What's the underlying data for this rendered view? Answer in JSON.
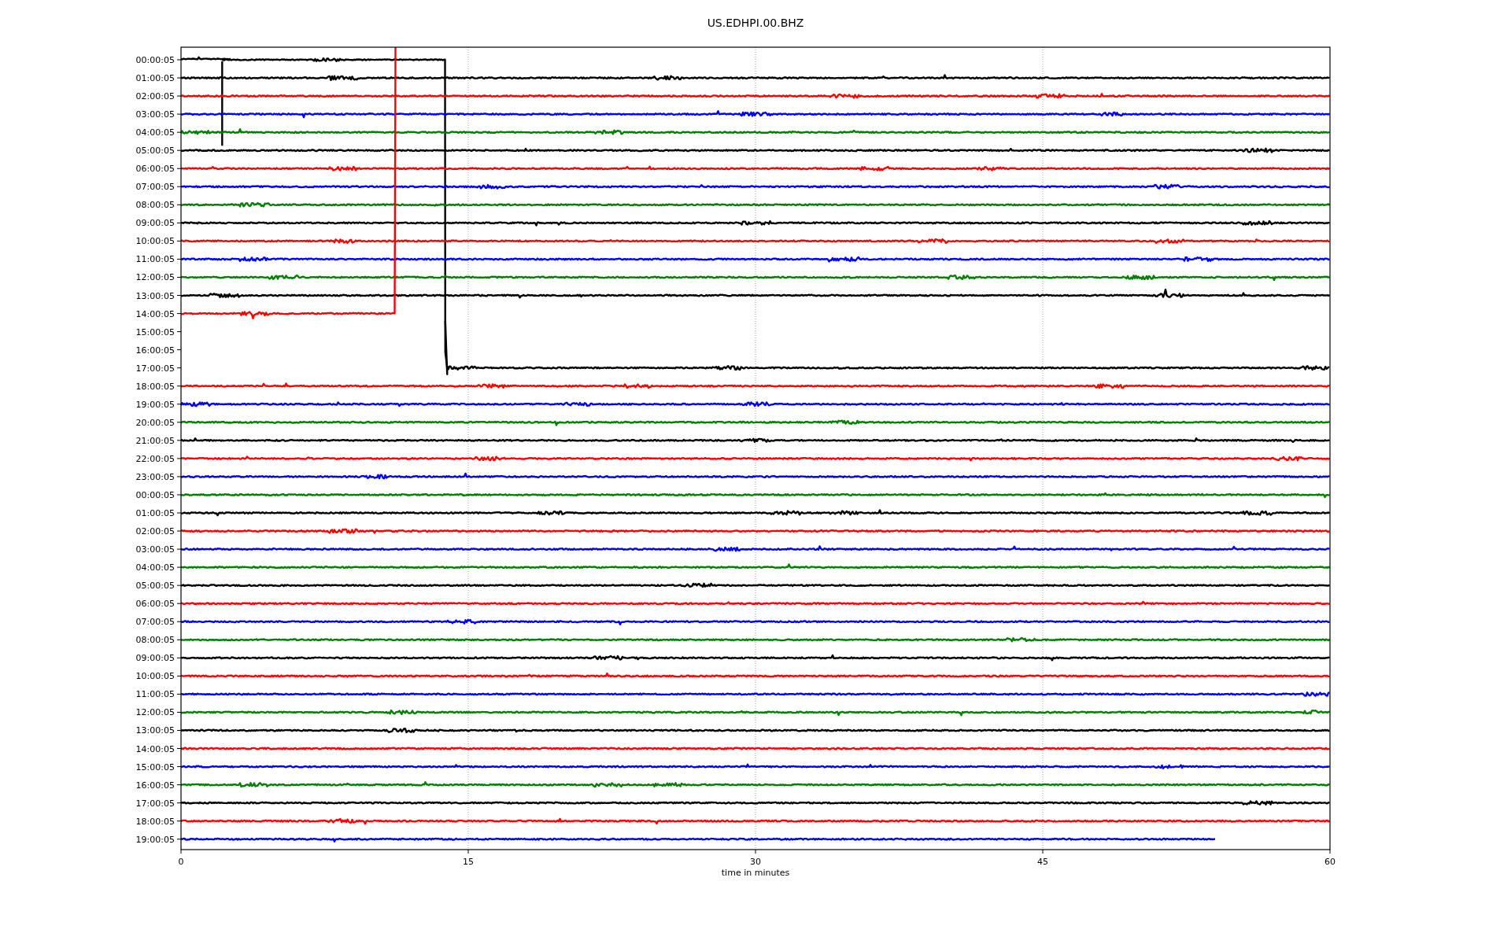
{
  "title": "US.EDHPI.00.BHZ",
  "xlabel": "time in minutes",
  "xticks": [
    "0",
    "15",
    "30",
    "45",
    "60"
  ],
  "rows": [
    {
      "label": "00:00:05",
      "color": "#000000",
      "kind": "step-start"
    },
    {
      "label": "01:00:05",
      "color": "#000000",
      "kind": "full"
    },
    {
      "label": "02:00:05",
      "color": "#ff0000",
      "kind": "full"
    },
    {
      "label": "03:00:05",
      "color": "#0000ff",
      "kind": "full"
    },
    {
      "label": "04:00:05",
      "color": "#008000",
      "kind": "full"
    },
    {
      "label": "05:00:05",
      "color": "#000000",
      "kind": "full"
    },
    {
      "label": "06:00:05",
      "color": "#ff0000",
      "kind": "full"
    },
    {
      "label": "07:00:05",
      "color": "#0000ff",
      "kind": "full"
    },
    {
      "label": "08:00:05",
      "color": "#008000",
      "kind": "full"
    },
    {
      "label": "09:00:05",
      "color": "#000000",
      "kind": "full"
    },
    {
      "label": "10:00:05",
      "color": "#ff0000",
      "kind": "full"
    },
    {
      "label": "11:00:05",
      "color": "#0000ff",
      "kind": "full"
    },
    {
      "label": "12:00:05",
      "color": "#008000",
      "kind": "full"
    },
    {
      "label": "13:00:05",
      "color": "#000000",
      "kind": "full"
    },
    {
      "label": "14:00:05",
      "color": "#ff0000",
      "kind": "cut-short"
    },
    {
      "label": "15:00:05",
      "kind": "empty"
    },
    {
      "label": "16:00:05",
      "kind": "empty"
    },
    {
      "label": "17:00:05",
      "color": "#000000",
      "kind": "late-start"
    },
    {
      "label": "18:00:05",
      "color": "#ff0000",
      "kind": "full"
    },
    {
      "label": "19:00:05",
      "color": "#0000ff",
      "kind": "full"
    },
    {
      "label": "20:00:05",
      "color": "#008000",
      "kind": "full"
    },
    {
      "label": "21:00:05",
      "color": "#000000",
      "kind": "full"
    },
    {
      "label": "22:00:05",
      "color": "#ff0000",
      "kind": "full"
    },
    {
      "label": "23:00:05",
      "color": "#0000ff",
      "kind": "full"
    },
    {
      "label": "00:00:05",
      "color": "#008000",
      "kind": "full"
    },
    {
      "label": "01:00:05",
      "color": "#000000",
      "kind": "full"
    },
    {
      "label": "02:00:05",
      "color": "#ff0000",
      "kind": "full"
    },
    {
      "label": "03:00:05",
      "color": "#0000ff",
      "kind": "full"
    },
    {
      "label": "04:00:05",
      "color": "#008000",
      "kind": "full"
    },
    {
      "label": "05:00:05",
      "color": "#000000",
      "kind": "full"
    },
    {
      "label": "06:00:05",
      "color": "#ff0000",
      "kind": "full"
    },
    {
      "label": "07:00:05",
      "color": "#0000ff",
      "kind": "full"
    },
    {
      "label": "08:00:05",
      "color": "#008000",
      "kind": "full"
    },
    {
      "label": "09:00:05",
      "color": "#000000",
      "kind": "full"
    },
    {
      "label": "10:00:05",
      "color": "#ff0000",
      "kind": "full"
    },
    {
      "label": "11:00:05",
      "color": "#0000ff",
      "kind": "full"
    },
    {
      "label": "12:00:05",
      "color": "#008000",
      "kind": "full"
    },
    {
      "label": "13:00:05",
      "color": "#000000",
      "kind": "full"
    },
    {
      "label": "14:00:05",
      "color": "#ff0000",
      "kind": "full"
    },
    {
      "label": "15:00:05",
      "color": "#0000ff",
      "kind": "full"
    },
    {
      "label": "16:00:05",
      "color": "#008000",
      "kind": "full"
    },
    {
      "label": "17:00:05",
      "color": "#000000",
      "kind": "full"
    },
    {
      "label": "18:00:05",
      "color": "#ff0000",
      "kind": "full"
    },
    {
      "label": "19:00:05",
      "color": "#0000ff",
      "kind": "truncated"
    }
  ]
}
